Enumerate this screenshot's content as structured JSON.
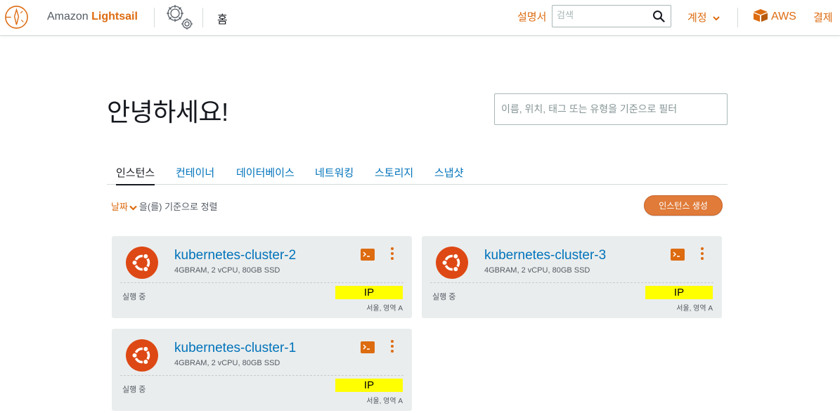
{
  "header": {
    "brand_prefix": "Amazon",
    "brand_name": "Lightsail",
    "home_label": "홈",
    "docs_label": "설명서",
    "search_placeholder": "검색",
    "account_label": "계정",
    "aws_label": "AWS",
    "billing_label": "결제"
  },
  "greeting": "안녕하세요!",
  "filter_placeholder": "이름, 위치, 태그 또는 유형을 기준으로 필터",
  "tabs": [
    {
      "label": "인스턴스",
      "active": true
    },
    {
      "label": "컨테이너",
      "active": false
    },
    {
      "label": "데이터베이스",
      "active": false
    },
    {
      "label": "네트워킹",
      "active": false
    },
    {
      "label": "스토리지",
      "active": false
    },
    {
      "label": "스냅샷",
      "active": false
    }
  ],
  "sort": {
    "key": "날짜",
    "suffix": "을(를) 기준으로 정렬"
  },
  "create_button": "인스턴스 생성",
  "instances": [
    {
      "name": "kubernetes-cluster-2",
      "spec": "4GBRAM, 2 vCPU, 80GB SSD",
      "state": "실행 중",
      "ip": "IP",
      "region": "서울, 영역 A"
    },
    {
      "name": "kubernetes-cluster-3",
      "spec": "4GBRAM, 2 vCPU, 80GB SSD",
      "state": "실행 중",
      "ip": "IP",
      "region": "서울, 영역 A"
    },
    {
      "name": "kubernetes-cluster-1",
      "spec": "4GBRAM, 2 vCPU, 80GB SSD",
      "state": "실행 중",
      "ip": "IP",
      "region": "서울, 영역 A"
    }
  ],
  "colors": {
    "accent_orange": "#dd6b10",
    "link_blue": "#0073bb",
    "card_bg": "#eaeded",
    "ubuntu_orange": "#dd4814",
    "ip_highlight": "#ffff00"
  },
  "icons": {
    "logo": "lightsail-logo-icon",
    "gear": "settings-gear-icon",
    "search": "search-icon",
    "account_caret": "chevron-down-icon",
    "aws": "aws-box-icon",
    "os": "ubuntu-logo-icon",
    "connect": "terminal-icon",
    "menu": "kebab-menu-icon"
  }
}
